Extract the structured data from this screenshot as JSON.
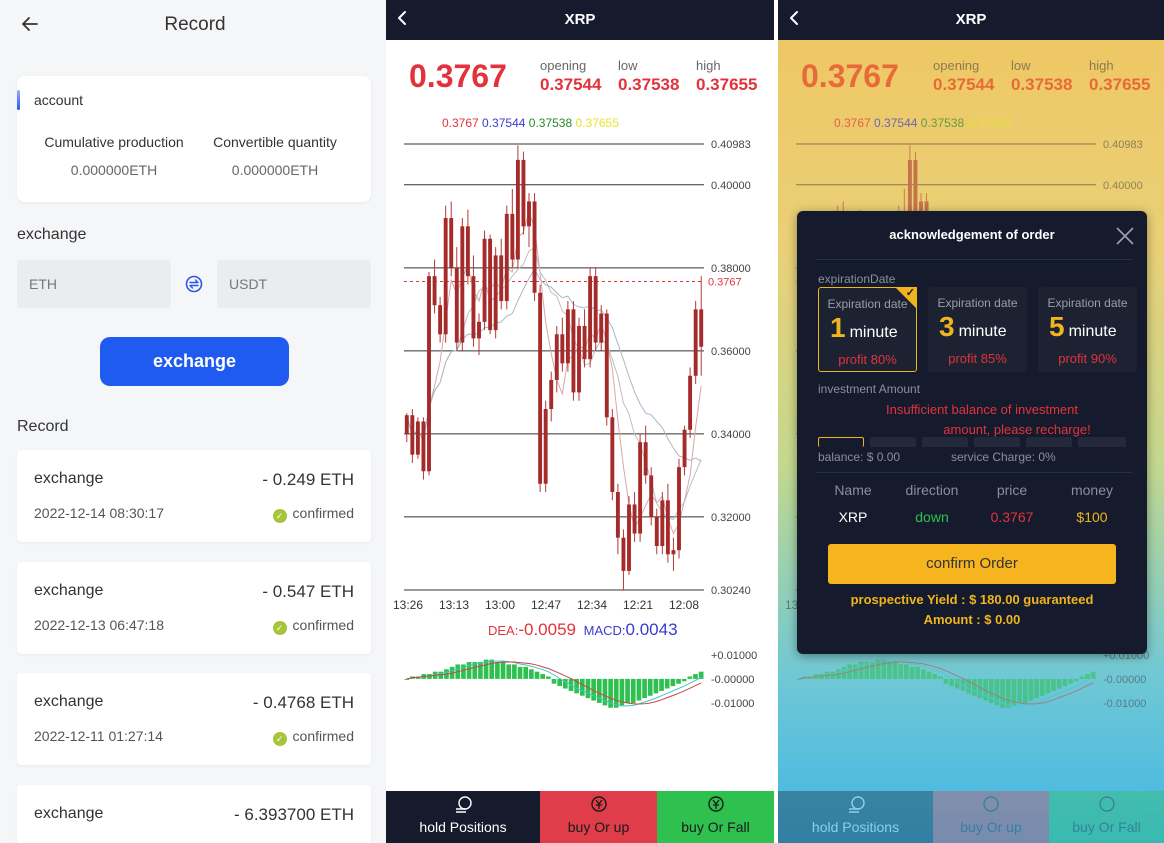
{
  "record_page": {
    "title": "Record",
    "account": {
      "label": "account",
      "cumulative_label": "Cumulative production",
      "cumulative_value": "0.000000ETH",
      "convertible_label": "Convertible quantity",
      "convertible_value": "0.000000ETH"
    },
    "exchange": {
      "label": "exchange",
      "from_placeholder": "ETH",
      "to_placeholder": "USDT",
      "button_label": "exchange"
    },
    "record_label": "Record",
    "records": [
      {
        "type": "exchange",
        "amount": "- 0.249 ETH",
        "date": "2022-12-14 08:30:17",
        "status": "confirmed"
      },
      {
        "type": "exchange",
        "amount": "- 0.547 ETH",
        "date": "2022-12-13 06:47:18",
        "status": "confirmed"
      },
      {
        "type": "exchange",
        "amount": "- 0.4768 ETH",
        "date": "2022-12-11 01:27:14",
        "status": "confirmed"
      },
      {
        "type": "exchange",
        "amount": "- 6.393700 ETH",
        "date": "",
        "status": ""
      }
    ]
  },
  "chart_page": {
    "title": "XRP",
    "price": "0.3767",
    "opening_label": "opening",
    "opening_value": "0.37544",
    "low_label": "low",
    "low_value": "0.37538",
    "high_label": "high",
    "high_value": "0.37655",
    "ma_values": [
      "0.3767",
      "0.37544",
      "0.37538",
      "0.37655"
    ],
    "macd": {
      "dea_label": "DEA:",
      "dea_value": "-0.0059",
      "macd_label": "MACD:",
      "macd_value": "0.0043"
    },
    "tabs": [
      "hold Positions",
      "buy Or up",
      "buy Or Fall"
    ]
  },
  "chart_data": [
    {
      "type": "candlestick",
      "title": "XRP",
      "x_ticks": [
        "13:26",
        "13:13",
        "13:00",
        "12:47",
        "12:34",
        "12:21",
        "12:08"
      ],
      "y_ticks": [
        "0.40983",
        "0.40000",
        "0.38000",
        "0.36000",
        "0.34000",
        "0.32000",
        "0.30240"
      ],
      "ylim": [
        0.3024,
        0.40983
      ],
      "current_price_marker": "0.3767",
      "ohlc": [
        [
          0.34,
          0.345,
          0.338,
          0.3445
        ],
        [
          0.3445,
          0.346,
          0.333,
          0.335
        ],
        [
          0.335,
          0.344,
          0.334,
          0.343
        ],
        [
          0.343,
          0.344,
          0.329,
          0.331
        ],
        [
          0.331,
          0.379,
          0.33,
          0.378
        ],
        [
          0.378,
          0.382,
          0.369,
          0.371
        ],
        [
          0.371,
          0.373,
          0.362,
          0.364
        ],
        [
          0.364,
          0.395,
          0.362,
          0.392
        ],
        [
          0.392,
          0.396,
          0.378,
          0.38
        ],
        [
          0.38,
          0.385,
          0.36,
          0.362
        ],
        [
          0.362,
          0.392,
          0.36,
          0.39
        ],
        [
          0.39,
          0.394,
          0.376,
          0.378
        ],
        [
          0.378,
          0.383,
          0.361,
          0.363
        ],
        [
          0.363,
          0.369,
          0.359,
          0.367
        ],
        [
          0.367,
          0.389,
          0.365,
          0.387
        ],
        [
          0.387,
          0.388,
          0.364,
          0.365
        ],
        [
          0.365,
          0.385,
          0.363,
          0.383
        ],
        [
          0.383,
          0.387,
          0.37,
          0.372
        ],
        [
          0.372,
          0.395,
          0.37,
          0.393
        ],
        [
          0.393,
          0.399,
          0.38,
          0.382
        ],
        [
          0.382,
          0.4095,
          0.38,
          0.406
        ],
        [
          0.406,
          0.408,
          0.388,
          0.39
        ],
        [
          0.39,
          0.398,
          0.385,
          0.396
        ],
        [
          0.396,
          0.398,
          0.372,
          0.374
        ],
        [
          0.374,
          0.376,
          0.326,
          0.328
        ],
        [
          0.328,
          0.348,
          0.326,
          0.346
        ],
        [
          0.346,
          0.355,
          0.343,
          0.353
        ],
        [
          0.353,
          0.366,
          0.35,
          0.364
        ],
        [
          0.364,
          0.368,
          0.355,
          0.357
        ],
        [
          0.357,
          0.372,
          0.355,
          0.37
        ],
        [
          0.37,
          0.372,
          0.348,
          0.35
        ],
        [
          0.35,
          0.368,
          0.348,
          0.366
        ],
        [
          0.366,
          0.37,
          0.356,
          0.358
        ],
        [
          0.358,
          0.38,
          0.356,
          0.378
        ],
        [
          0.378,
          0.38,
          0.36,
          0.362
        ],
        [
          0.362,
          0.371,
          0.36,
          0.369
        ],
        [
          0.369,
          0.37,
          0.342,
          0.344
        ],
        [
          0.344,
          0.346,
          0.324,
          0.326
        ],
        [
          0.326,
          0.328,
          0.311,
          0.315
        ],
        [
          0.315,
          0.317,
          0.3024,
          0.307
        ],
        [
          0.307,
          0.325,
          0.306,
          0.323
        ],
        [
          0.323,
          0.326,
          0.314,
          0.316
        ],
        [
          0.316,
          0.34,
          0.314,
          0.338
        ],
        [
          0.338,
          0.342,
          0.328,
          0.33
        ],
        [
          0.33,
          0.332,
          0.318,
          0.32
        ],
        [
          0.32,
          0.322,
          0.311,
          0.313
        ],
        [
          0.313,
          0.326,
          0.311,
          0.324
        ],
        [
          0.324,
          0.328,
          0.309,
          0.311
        ],
        [
          0.311,
          0.315,
          0.307,
          0.312
        ],
        [
          0.312,
          0.334,
          0.31,
          0.332
        ],
        [
          0.332,
          0.342,
          0.33,
          0.341
        ],
        [
          0.341,
          0.356,
          0.339,
          0.354
        ],
        [
          0.354,
          0.372,
          0.352,
          0.37
        ],
        [
          0.37,
          0.378,
          0.354,
          0.361
        ]
      ]
    },
    {
      "type": "bar",
      "title": "MACD",
      "y_ticks": [
        "+0.01000",
        "-0.00000",
        "-0.01000"
      ],
      "ylim": [
        -0.015,
        0.012
      ],
      "values": [
        0.0,
        0.001,
        0.001,
        0.002,
        0.002,
        0.003,
        0.003,
        0.004,
        0.005,
        0.006,
        0.006,
        0.007,
        0.007,
        0.007,
        0.008,
        0.008,
        0.007,
        0.007,
        0.006,
        0.006,
        0.005,
        0.005,
        0.004,
        0.003,
        0.002,
        0.001,
        -0.002,
        -0.003,
        -0.004,
        -0.005,
        -0.006,
        -0.007,
        -0.008,
        -0.009,
        -0.01,
        -0.011,
        -0.012,
        -0.012,
        -0.011,
        -0.01,
        -0.01,
        -0.009,
        -0.008,
        -0.007,
        -0.006,
        -0.005,
        -0.004,
        -0.003,
        -0.002,
        -0.001,
        0.001,
        0.002,
        0.003
      ]
    }
  ],
  "order_page": {
    "title": "XRP",
    "modal_title": "acknowledgement of order",
    "expiration_label": "expirationDate",
    "options": [
      {
        "top": "Expiration date",
        "num": "1",
        "unit": "minute",
        "profit": "profit 80%"
      },
      {
        "top": "Expiration date",
        "num": "3",
        "unit": "minute",
        "profit": "profit 85%"
      },
      {
        "top": "Expiration date",
        "num": "5",
        "unit": "minute",
        "profit": "profit 90%"
      }
    ],
    "investment_label": "investment Amount",
    "warning_line1": "Insufficient balance of investment",
    "warning_line2": "amount, please recharge!",
    "balance": "balance: $ 0.00",
    "service_charge": "service Charge:  0%",
    "headers": [
      "Name",
      "direction",
      "price",
      "money"
    ],
    "row": {
      "name": "XRP",
      "direction": "down",
      "price": "0.3767",
      "money": "$100"
    },
    "confirm_label": "confirm Order",
    "yield_line1": "prospective Yield : $ 180.00    guaranteed",
    "yield_line2": "Amount : $ 0.00",
    "tabs": [
      "hold Positions",
      "buy Or up",
      "buy Or Fall"
    ]
  },
  "colors": {
    "primary": "#1f5bf0",
    "up_red": "#e2333c",
    "down_green": "#2ec14f",
    "gold": "#f0b51c",
    "navy": "#151b2c"
  }
}
